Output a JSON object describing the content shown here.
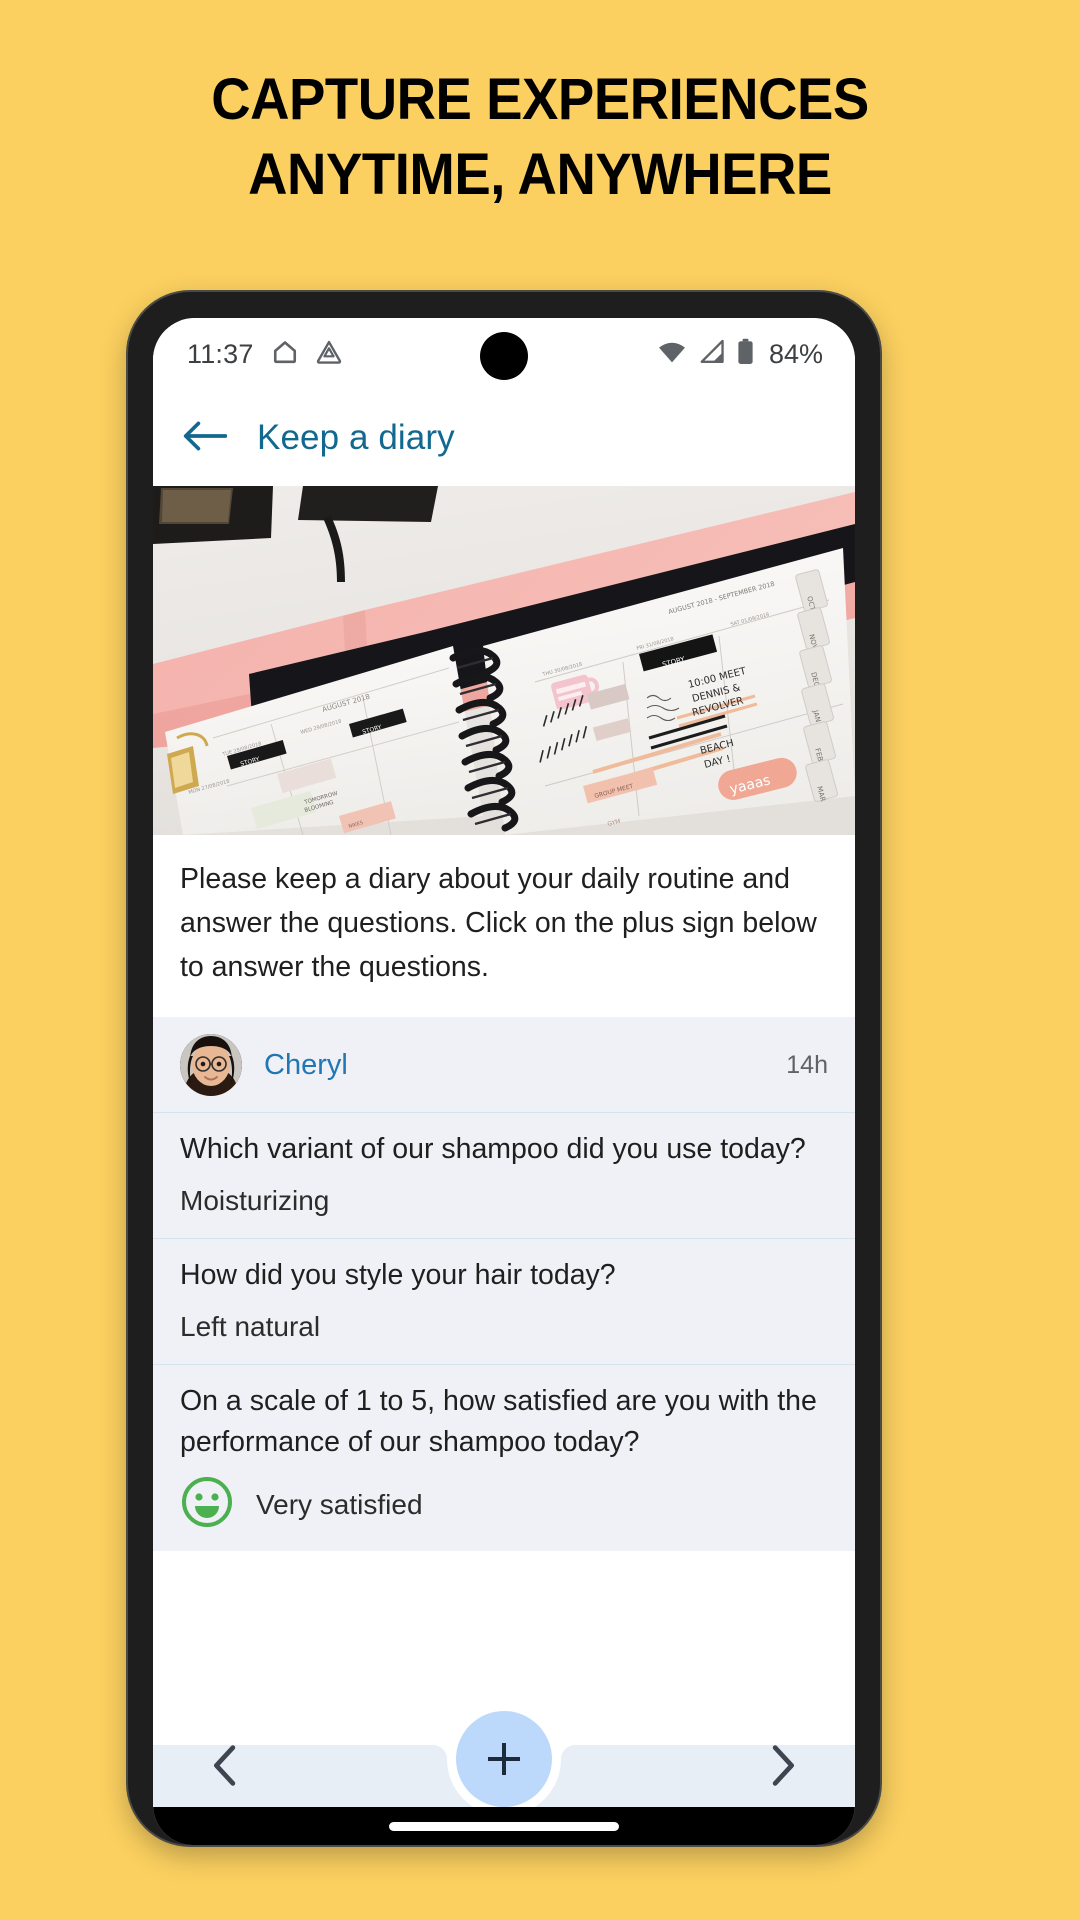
{
  "headline": {
    "line1": "CAPTURE EXPERIENCES",
    "line2": "ANYTIME, ANYWHERE",
    "color": "#000000"
  },
  "background_color": "#FBD060",
  "phone": {
    "statusbar": {
      "time": "11:37",
      "icons": [
        "home-shape-icon",
        "drive-triangle-icon",
        "wifi-icon",
        "cellular-signal-icon",
        "battery-icon"
      ],
      "battery_percent": "84%"
    },
    "appbar": {
      "back_label": "back-arrow",
      "title": "Keep a diary",
      "title_color": "#12688f"
    },
    "hero": {
      "alt": "Open spiral planner notebook with pink cover on a white desk"
    },
    "description": "Please keep a diary about your daily routine and answer the questions. Click on the plus sign below to answer the questions.",
    "entry": {
      "author": "Cheryl",
      "author_color": "#1f77b4",
      "timestamp": "14h",
      "qa": [
        {
          "question": "Which variant of our shampoo did you use today?",
          "answer": "Moisturizing",
          "type": "text"
        },
        {
          "question": "How did you style your hair today?",
          "answer": "Left natural",
          "type": "text"
        },
        {
          "question": "On a scale of 1 to 5, how satisfied are you with the performance of our shampoo today?",
          "answer": "Very satisfied",
          "type": "rating",
          "icon": "smiley-face-icon",
          "icon_color": "#4caf50"
        }
      ]
    },
    "bottomnav": {
      "prev_label": "chevron-left-icon",
      "next_label": "chevron-right-icon",
      "fab_label": "+",
      "fab_color": "#bcd9fb"
    }
  }
}
